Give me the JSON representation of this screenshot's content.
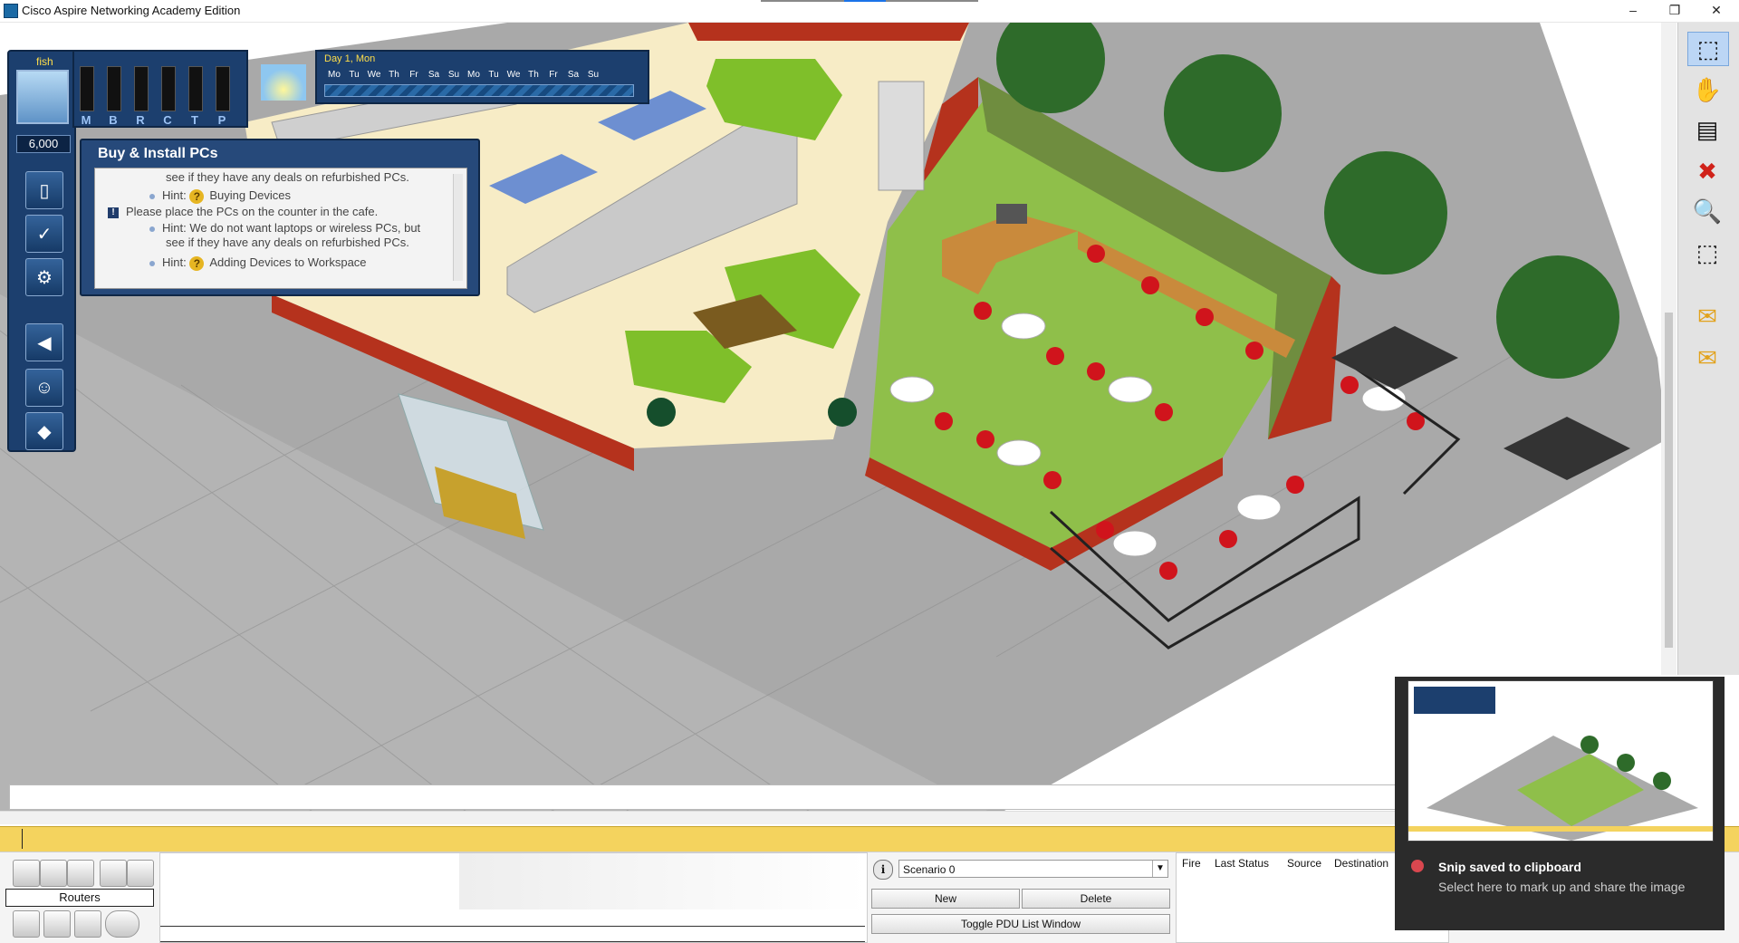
{
  "window": {
    "title": "Cisco Aspire Networking Academy Edition",
    "minimize_glyph": "–",
    "restore_glyph": "❐",
    "close_glyph": "✕"
  },
  "hud": {
    "player_name": "fish",
    "money": "6,000",
    "stat_letters": [
      "M",
      "B",
      "R",
      "C",
      "T",
      "P"
    ],
    "day_label": "Day 1, Mon",
    "weekdays": [
      "Mo",
      "Tu",
      "We",
      "Th",
      "Fr",
      "Sa",
      "Su",
      "Mo",
      "Tu",
      "We",
      "Th",
      "Fr",
      "Sa",
      "Su"
    ]
  },
  "hint_panel": {
    "title": "Buy & Install PCs",
    "lines": [
      "see if they have any deals on refurbished PCs.",
      "Hint:",
      "Buying Devices",
      "Please place the PCs on the counter in the cafe.",
      "Hint: We do not want laptops or wireless PCs, but",
      "see if they have any deals on refurbished PCs.",
      "Hint:",
      "Adding Devices to Workspace"
    ]
  },
  "right_toolbar": {
    "tools": [
      "select-icon",
      "hand-icon",
      "note-icon",
      "delete-icon",
      "inspect-icon",
      "resize-icon",
      "add-simple-pdu-icon",
      "add-complex-pdu-icon"
    ]
  },
  "bottom": {
    "device_category_label": "Routers",
    "scenario_selected": "Scenario 0",
    "new_label": "New",
    "delete_label": "Delete",
    "toggle_pdu_label": "Toggle PDU List Window",
    "pdu_columns": [
      "Fire",
      "Last Status",
      "Source",
      "Destination"
    ]
  },
  "toast": {
    "title": "Snip saved to clipboard",
    "body": "Select here to mark up and share the image"
  },
  "colors": {
    "hud_blue": "#1c3f6e",
    "timeline_yellow": "#f4d35e",
    "grass": "#8fbf4a",
    "brick": "#b5321d"
  }
}
